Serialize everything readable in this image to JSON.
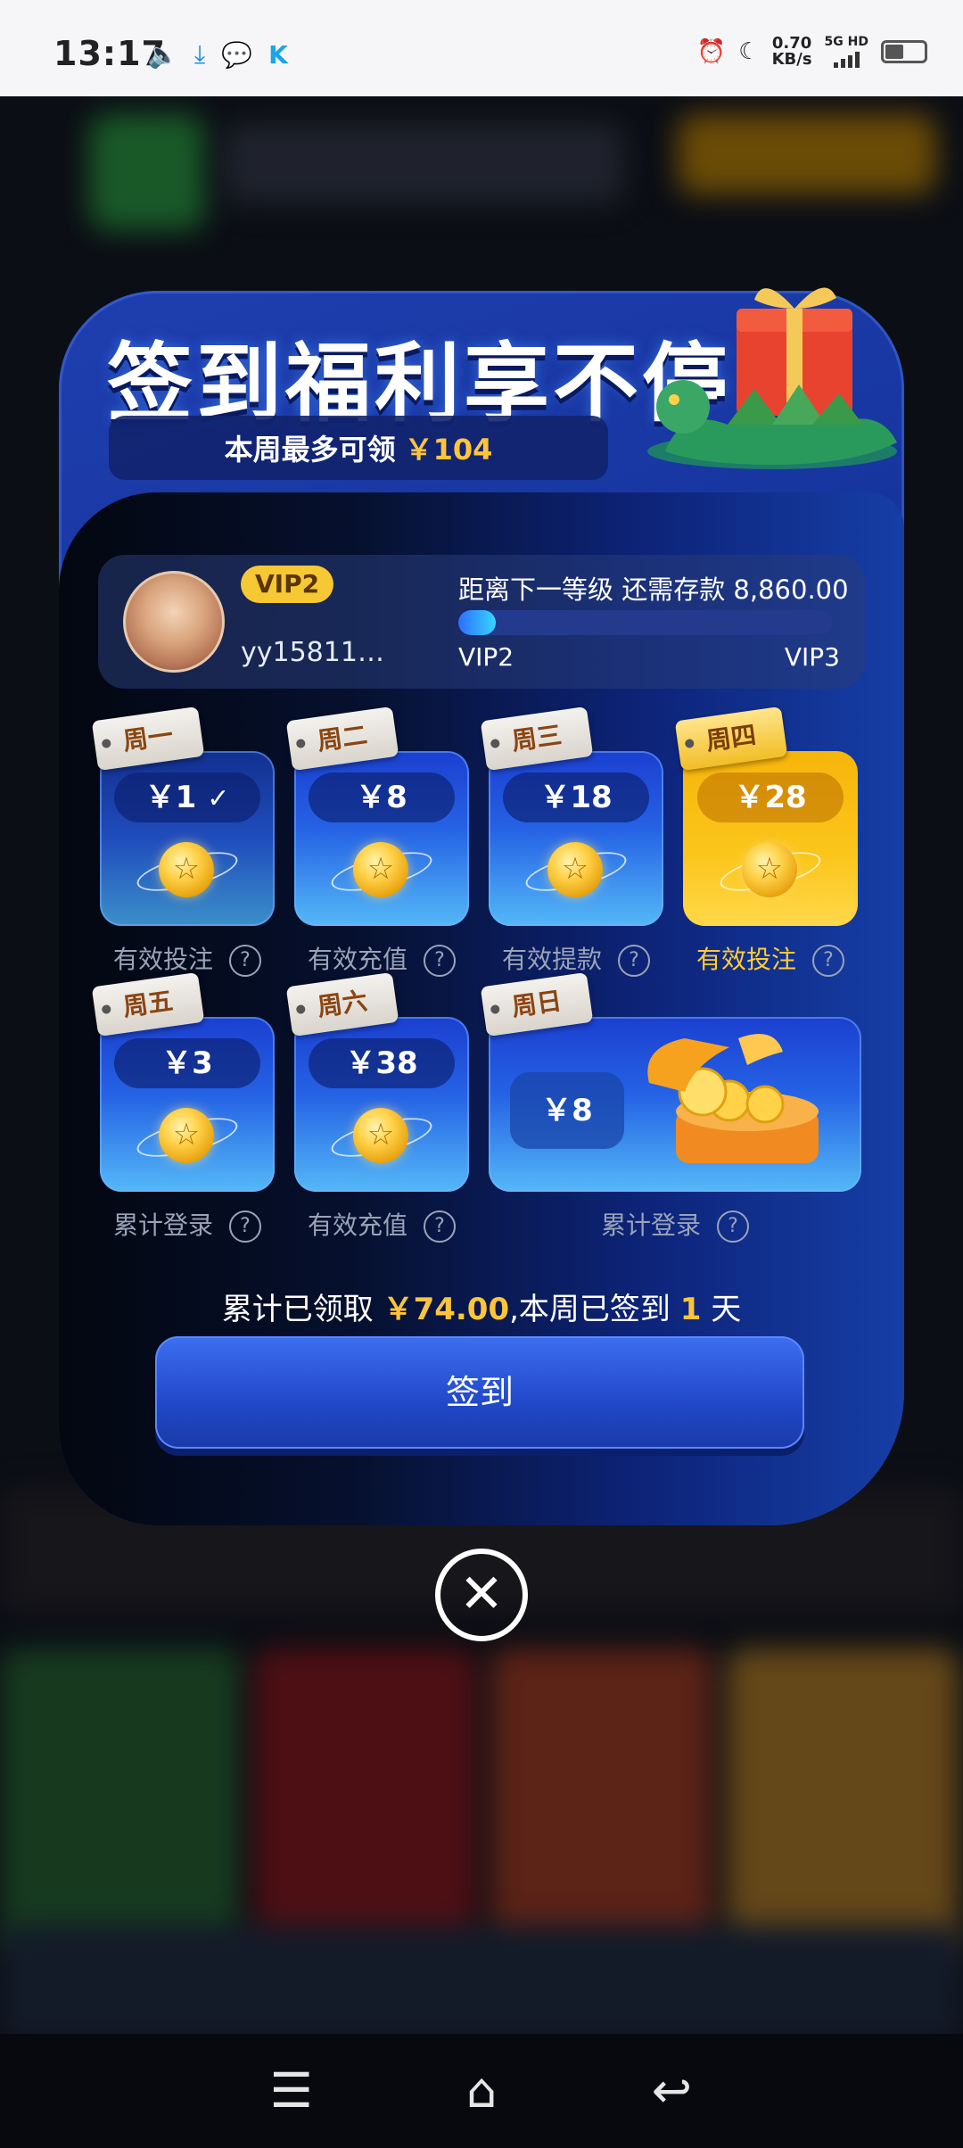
{
  "status_bar": {
    "time": "13:17",
    "net_speed_value": "0.70",
    "net_speed_unit": "KB/s",
    "net_type": "5G HD",
    "left_icons": [
      "volume-icon",
      "download-icon",
      "wechat-icon",
      "k-app-icon"
    ],
    "right_icons": [
      "alarm-icon",
      "moon-icon",
      "signal-icon",
      "battery-icon"
    ]
  },
  "modal": {
    "title": "签到福利享不停",
    "weekly_max_label": "本周最多可领",
    "weekly_max_amount": "￥104",
    "user": {
      "vip_level": "VIP2",
      "username": "yy15811…",
      "next_level_text": "距离下一等级 还需存款 8,860.00",
      "progress_from": "VIP2",
      "progress_to": "VIP3",
      "progress_fraction": 0.1
    },
    "days": [
      {
        "tag": "周一",
        "amount": "￥1",
        "label": "有效投注",
        "state": "done",
        "check": "✓"
      },
      {
        "tag": "周二",
        "amount": "￥8",
        "label": "有效充值",
        "state": "pending"
      },
      {
        "tag": "周三",
        "amount": "￥18",
        "label": "有效提款",
        "state": "pending"
      },
      {
        "tag": "周四",
        "amount": "￥28",
        "label": "有效投注",
        "state": "today"
      },
      {
        "tag": "周五",
        "amount": "￥3",
        "label": "累计登录",
        "state": "pending"
      },
      {
        "tag": "周六",
        "amount": "￥38",
        "label": "有效充值",
        "state": "pending"
      },
      {
        "tag": "周日",
        "amount": "￥8",
        "label": "累计登录",
        "state": "pending"
      }
    ],
    "help_icon": "?",
    "summary": {
      "prefix": "累计已领取",
      "amount": "￥74.00",
      "middle": ",本周已签到",
      "days": "1",
      "suffix": "天"
    },
    "signin_button": "签到",
    "close_icon": "✕"
  },
  "nav_bar": {
    "menu_icon": "☰",
    "home_icon": "⌂",
    "back_icon": "↩"
  },
  "colors": {
    "accent_gold": "#ffc53a",
    "modal_blue": "#1736a0",
    "vip_badge": "#f5c834"
  }
}
